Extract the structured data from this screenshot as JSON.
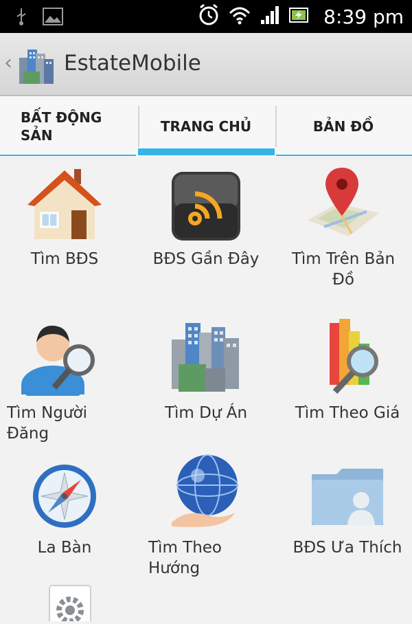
{
  "status_bar": {
    "time": "8:39 pm",
    "icons": [
      "usb-icon",
      "image-icon",
      "alarm-icon",
      "wifi-icon",
      "signal-icon",
      "battery-charging-icon"
    ]
  },
  "action_bar": {
    "title": "EstateMobile",
    "icon": "city-buildings-icon"
  },
  "tabs": [
    {
      "label": "BẤT ĐỘNG\nSẢN",
      "selected": false
    },
    {
      "label": "TRANG CHỦ",
      "selected": true
    },
    {
      "label": "BẢN ĐỒ",
      "selected": false
    }
  ],
  "grid": [
    {
      "label": "Tìm BĐS",
      "icon": "house-icon"
    },
    {
      "label": "BĐS Gần Đây",
      "icon": "rss-feed-icon"
    },
    {
      "label": "Tìm Trên Bản\nĐồ",
      "icon": "map-pin-icon"
    },
    {
      "label": "Tìm Người\nĐăng",
      "icon": "user-search-icon"
    },
    {
      "label": "Tìm Dự Án",
      "icon": "city-buildings-icon"
    },
    {
      "label": "Tìm Theo Giá",
      "icon": "chart-search-icon"
    },
    {
      "label": "La Bàn",
      "icon": "compass-icon"
    },
    {
      "label": "Tìm Theo\nHướng",
      "icon": "globe-hand-icon"
    },
    {
      "label": "BĐS Ưa Thích",
      "icon": "user-folder-icon"
    },
    {
      "label": "",
      "icon": "settings-gear-icon"
    }
  ],
  "colors": {
    "accent": "#33b5e5",
    "status_bar": "#000000",
    "background": "#f2f2f2"
  }
}
